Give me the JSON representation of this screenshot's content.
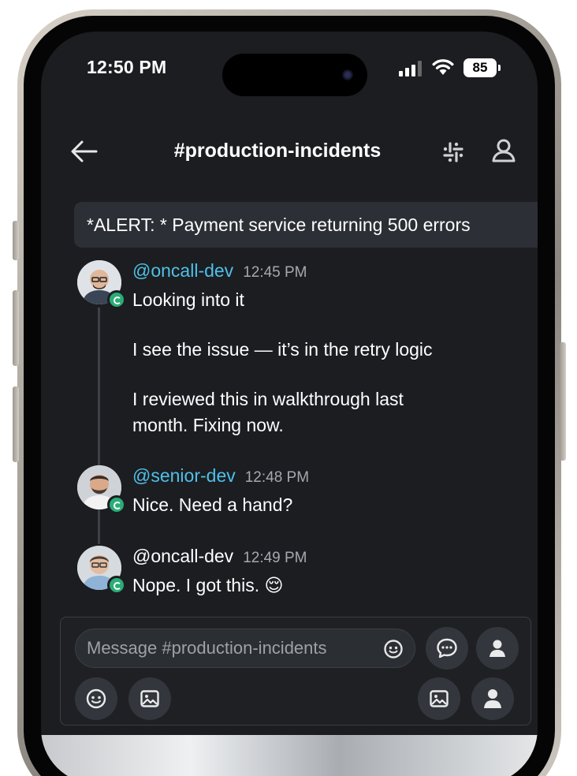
{
  "status_bar": {
    "time": "12:50 PM",
    "battery": "85"
  },
  "header": {
    "title": "#production-incidents"
  },
  "alert": {
    "text": "*ALERT: * Payment service returning 500 errors"
  },
  "messages": [
    {
      "user": "@oncall-dev",
      "time": "12:45 PM",
      "lines": [
        "Looking into it",
        "I see the issue — it’s in the retry logic",
        "I reviewed this in walkthrough last",
        "month. Fixing now."
      ]
    },
    {
      "user": "@senior-dev",
      "time": "12:48 PM",
      "lines": [
        "Nice. Need a hand?"
      ]
    },
    {
      "user": "@oncall-dev",
      "time": "12:49 PM",
      "lines": [
        "Nope. I got this. 😌"
      ]
    }
  ],
  "composer": {
    "placeholder": "Message #production-incidents"
  },
  "colors": {
    "background": "#1b1d21",
    "mention": "#4fc0e8",
    "online": "#2bac76",
    "banner": "#2c2f35"
  },
  "icons": [
    "back-arrow-icon",
    "slack-icon",
    "members-icon",
    "emoji-icon",
    "image-icon",
    "user-icon",
    "users-icon",
    "chat-bubble-icon"
  ]
}
